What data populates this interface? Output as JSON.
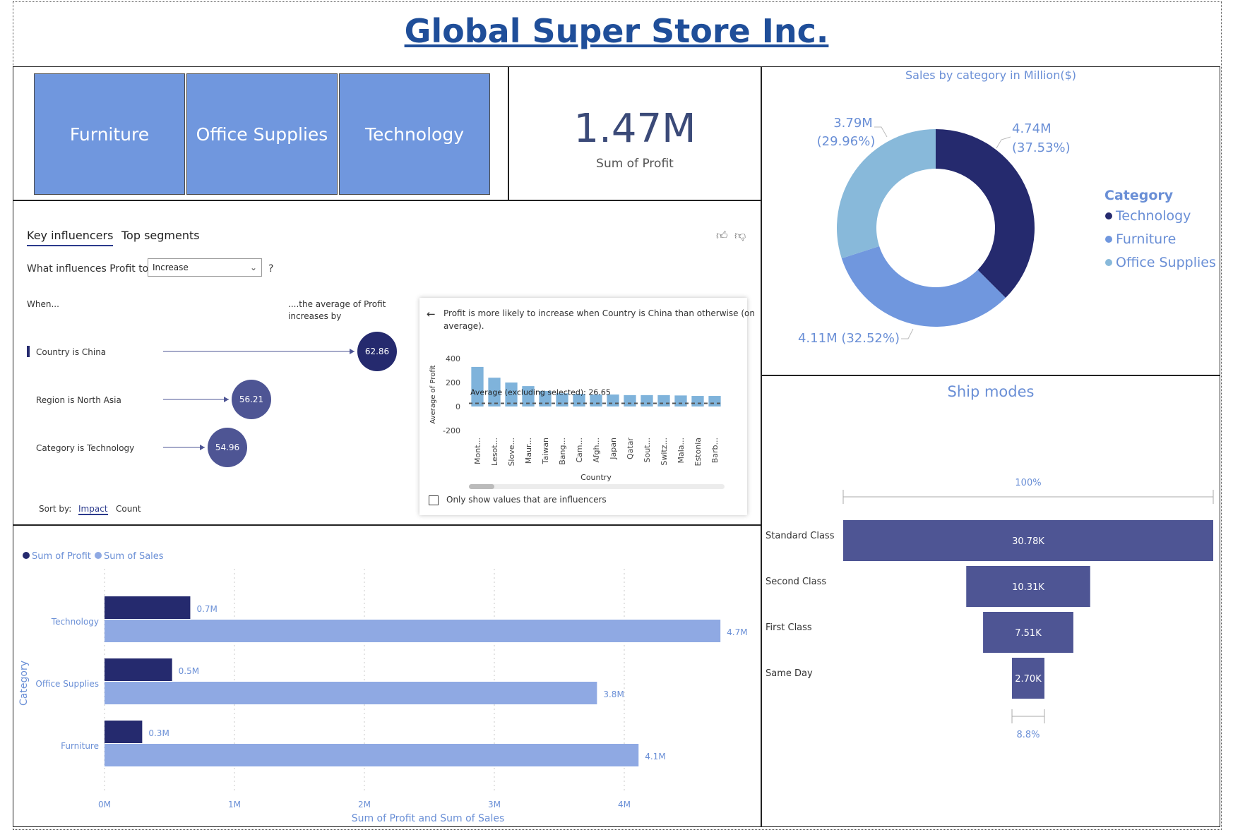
{
  "header": {
    "title": "Global Super Store Inc."
  },
  "slicers": [
    "Furniture",
    "Office Supplies",
    "Technology"
  ],
  "kpi": {
    "value": "1.47M",
    "label": "Sum of Profit"
  },
  "influencers": {
    "tabs": [
      "Key influencers",
      "Top segments"
    ],
    "question_prefix": "What influences Profit to",
    "dropdown_value": "Increase",
    "question_suffix": "?",
    "when_label": "When...",
    "avg_label_line1": "....the average of Profit",
    "avg_label_line2": "increases by",
    "items": [
      {
        "label": "Country is China",
        "value": "62.86"
      },
      {
        "label": "Region is North Asia",
        "value": "56.21"
      },
      {
        "label": "Category is Technology",
        "value": "54.96"
      }
    ],
    "sort_by": "Sort by:",
    "sort_impact": "Impact",
    "sort_count": "Count",
    "detail_line1": "Profit is more likely to increase when Country is China than otherwise (on",
    "detail_line2": "average).",
    "detail_checkbox": "Only show values that are influencers",
    "detail_avg_line": "Average (excluding selected): 26.65"
  },
  "chart_data": [
    {
      "type": "bar",
      "title": "",
      "xlabel": "Country",
      "ylabel": "Average of Profit",
      "ylim": [
        -200,
        400
      ],
      "yticks": [
        400,
        200,
        0,
        -200
      ],
      "categories": [
        "Mont...",
        "Lesot...",
        "Slove...",
        "Maur...",
        "Taiwan",
        "Bang...",
        "Cam...",
        "Afgh...",
        "Japan",
        "Qatar",
        "Sout...",
        "Switz...",
        "Mala...",
        "Estonia",
        "Barb..."
      ],
      "values": [
        330,
        240,
        200,
        170,
        130,
        110,
        105,
        100,
        100,
        95,
        95,
        95,
        92,
        88,
        88
      ],
      "reference_line": 26.65
    },
    {
      "type": "pie",
      "title": "Sales by category in Million($)",
      "legend_title": "Category",
      "legend_position": "right",
      "slices": [
        {
          "name": "Technology",
          "value": 4.74,
          "label": "4.74M",
          "pct": "(37.53%)",
          "color": "#252A6E"
        },
        {
          "name": "Furniture",
          "value": 4.11,
          "label": "4.11M (32.52%)",
          "color": "#7097DE"
        },
        {
          "name": "Office Supplies",
          "value": 3.79,
          "label": "3.79M",
          "pct": "(29.96%)",
          "color": "#88B9DA"
        }
      ]
    },
    {
      "type": "bar",
      "title": "",
      "xlabel": "Sum of Profit and Sum of Sales",
      "ylabel": "Category",
      "legend_position": "top-left",
      "categories": [
        "Technology",
        "Office Supplies",
        "Furniture"
      ],
      "xlim": [
        0,
        4.7
      ],
      "xticks": [
        "0M",
        "1M",
        "2M",
        "3M",
        "4M"
      ],
      "series": [
        {
          "name": "Sum of Profit",
          "color": "#252A6E",
          "values": [
            0.66,
            0.52,
            0.29
          ],
          "labels": [
            "0.7M",
            "0.5M",
            "0.3M"
          ]
        },
        {
          "name": "Sum of Sales",
          "color": "#8FA9E3",
          "values": [
            4.74,
            3.79,
            4.11
          ],
          "labels": [
            "4.7M",
            "3.8M",
            "4.1M"
          ]
        }
      ]
    },
    {
      "type": "funnel",
      "title": "Ship modes",
      "top_pct": "100%",
      "bottom_pct": "8.8%",
      "categories": [
        "Standard Class",
        "Second Class",
        "First Class",
        "Same Day"
      ],
      "values": [
        30780,
        10310,
        7510,
        2700
      ],
      "labels": [
        "30.78K",
        "10.31K",
        "7.51K",
        "2.70K"
      ],
      "color": "#4E5594"
    }
  ]
}
